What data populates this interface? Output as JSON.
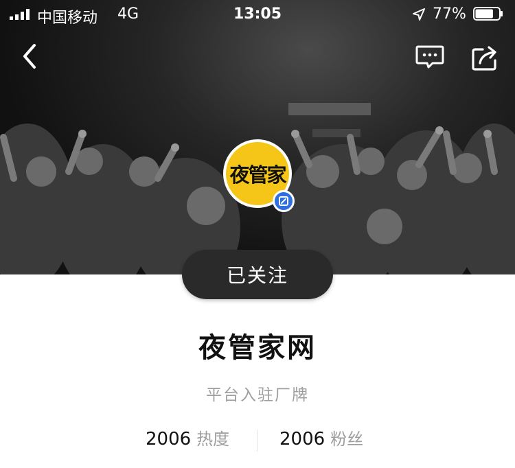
{
  "status_bar": {
    "carrier": "中国移动",
    "network": "4G",
    "time": "13:05",
    "battery_percent": "77%",
    "battery_level": 0.77
  },
  "nav": {
    "back_icon": "chevron-left-icon",
    "message_icon": "message-icon",
    "share_icon": "share-icon"
  },
  "profile": {
    "avatar_text": "夜管家",
    "avatar_color": "#f5c518",
    "badge_icon": "verified-badge-icon",
    "badge_color": "#2f6fe0",
    "follow_label": "已关注",
    "name": "夜管家网",
    "subtitle": "平台入驻厂牌",
    "stats": [
      {
        "value": "2006",
        "label": "热度"
      },
      {
        "value": "2006",
        "label": "粉丝"
      }
    ]
  }
}
